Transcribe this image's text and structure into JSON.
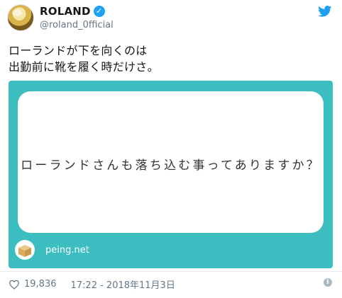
{
  "author": {
    "display_name": "ROLAND",
    "handle": "@roland_0fficial",
    "verified_icon": "verified-badge-icon",
    "avatar_icon": "profile-avatar"
  },
  "brand_icon": "twitter-bird-icon",
  "tweet": {
    "lines": [
      "ローランドが下を向くのは",
      "出勤前に靴を履く時だけさ。"
    ]
  },
  "card": {
    "question": "ローランドさんも落ち込む事ってありますか？",
    "domain": "peing.net",
    "logo_icon": "peing-box-icon",
    "background_color": "#3cbdc0"
  },
  "footer": {
    "like_icon": "heart-icon",
    "like_count": "19,836",
    "timestamp": "17:22 - 2018年11月3日",
    "info_icon": "info-icon"
  },
  "colors": {
    "accent": "#1da1f2",
    "muted_text": "#657786"
  }
}
